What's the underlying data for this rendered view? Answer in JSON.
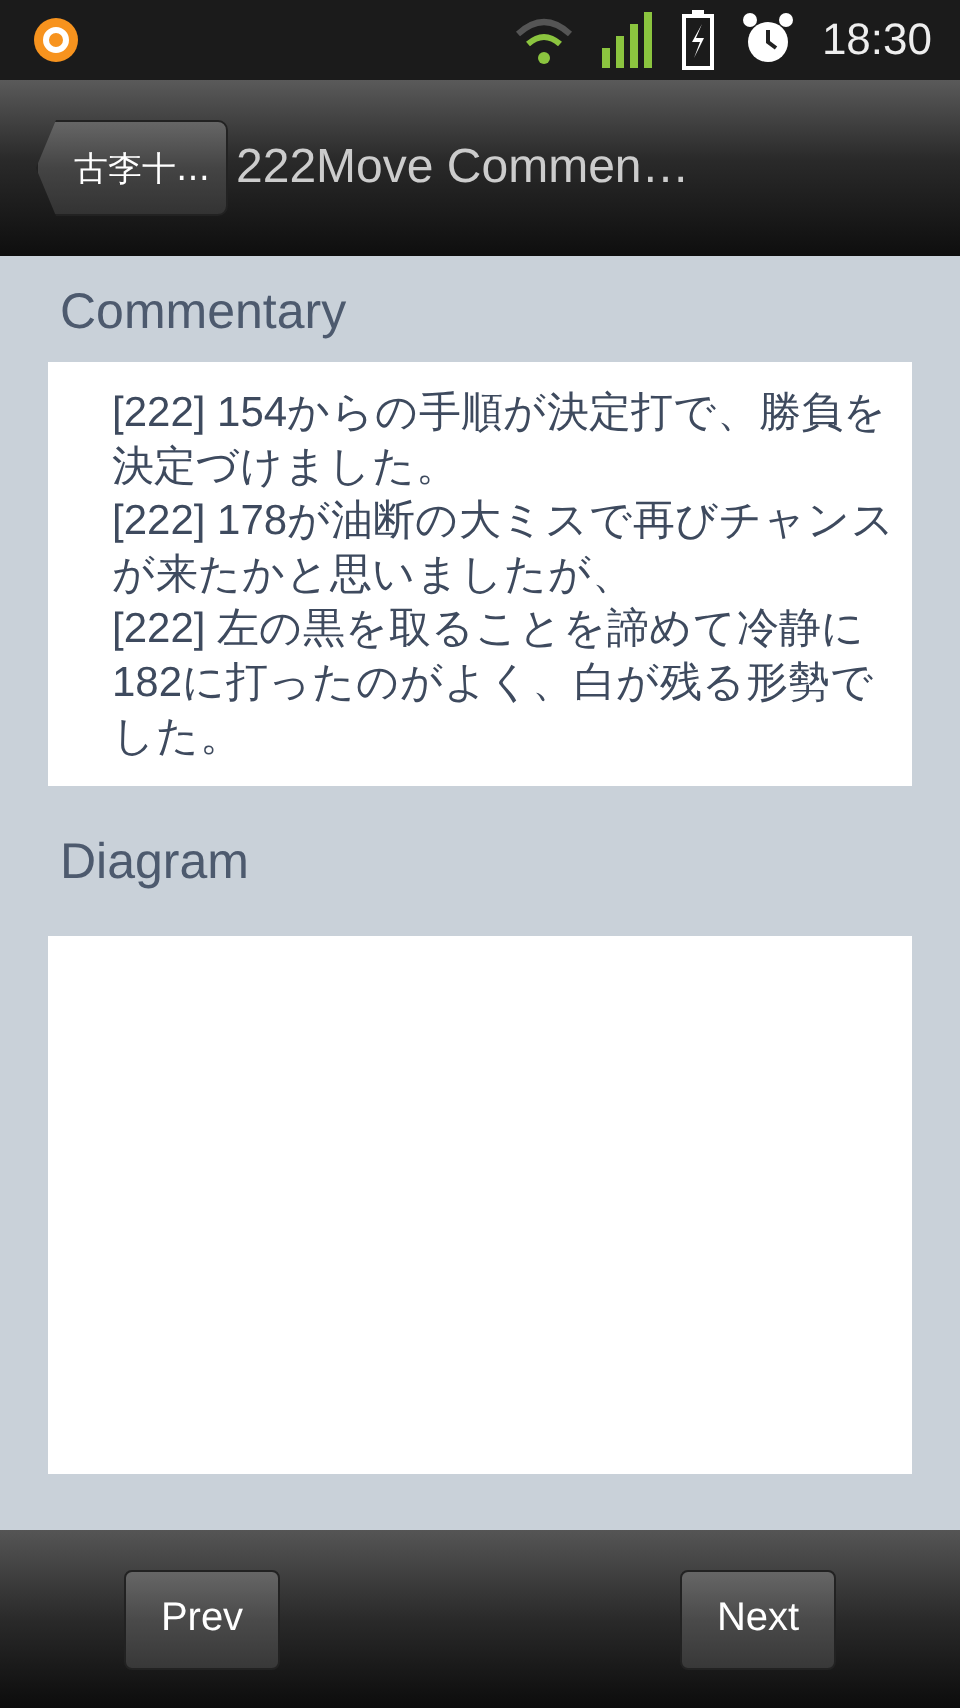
{
  "status_bar": {
    "time": "18:30"
  },
  "header": {
    "back_label": "古李十…",
    "title": "222Move Commen…"
  },
  "commentary": {
    "heading": "Commentary",
    "comments": [
      "[222] 154からの手順が決定打で、勝負を決定づけました。",
      "[222] 178が油断の大ミスで再びチャンスが来たかと思いましたが、",
      "[222] 左の黒を取ることを諦めて冷静に182に打ったのがよく、白が残る形勢でした。"
    ]
  },
  "diagram": {
    "heading": "Diagram"
  },
  "buttons": [
    "Prev",
    "Next"
  ]
}
